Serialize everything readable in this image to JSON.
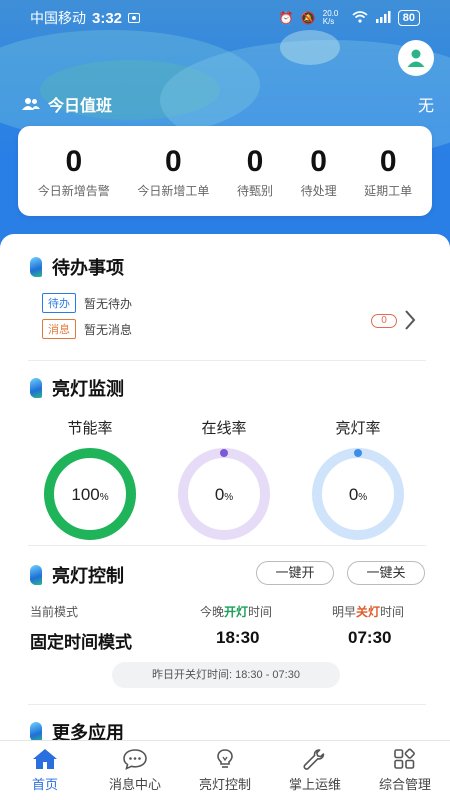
{
  "status_bar": {
    "carrier": "中国移动",
    "time": "3:32",
    "speed": "20.0 K/s",
    "battery": "80"
  },
  "duty": {
    "title": "今日值班",
    "value": "无"
  },
  "stats": [
    {
      "value": "0",
      "label": "今日新增告警"
    },
    {
      "value": "0",
      "label": "今日新增工单"
    },
    {
      "value": "0",
      "label": "待甄别"
    },
    {
      "value": "0",
      "label": "待处理"
    },
    {
      "value": "0",
      "label": "延期工单"
    }
  ],
  "todo": {
    "title": "待办事项",
    "items": [
      {
        "tag": "待办",
        "text": "暂无待办"
      },
      {
        "tag": "消息",
        "text": "暂无消息"
      }
    ],
    "count": "0"
  },
  "monitor": {
    "title": "亮灯监测",
    "gauges": [
      {
        "label": "节能率",
        "value": "100",
        "unit": "%",
        "fraction": 1.0,
        "color": "#1fb35a",
        "track": "#e3f5ea"
      },
      {
        "label": "在线率",
        "value": "0",
        "unit": "%",
        "fraction": 0.0,
        "color": "#7a5ad6",
        "track": "#e6dcf8"
      },
      {
        "label": "亮灯率",
        "value": "0",
        "unit": "%",
        "fraction": 0.0,
        "color": "#3d8ee8",
        "track": "#cfe4fb"
      }
    ]
  },
  "control": {
    "title": "亮灯控制",
    "btn_on": "一键开",
    "btn_off": "一键关",
    "mode_label": "当前模式",
    "mode_value": "固定时间模式",
    "tonight_pre": "今晚",
    "tonight_hl": "开灯",
    "tonight_post": "时间",
    "tonight_value": "18:30",
    "morning_pre": "明早",
    "morning_hl": "关灯",
    "morning_post": "时间",
    "morning_value": "07:30",
    "yesterday": "昨日开关灯时间:  18:30 - 07:30"
  },
  "more": {
    "title": "更多应用"
  },
  "tabs": [
    {
      "label": "首页",
      "icon": "home-icon",
      "active": true
    },
    {
      "label": "消息中心",
      "icon": "chat-icon",
      "active": false
    },
    {
      "label": "亮灯控制",
      "icon": "bulb-icon",
      "active": false
    },
    {
      "label": "掌上运维",
      "icon": "wrench-icon",
      "active": false
    },
    {
      "label": "综合管理",
      "icon": "grid-icon",
      "active": false
    }
  ],
  "colors": {
    "primary": "#2a7fe6",
    "tab_active": "#2a6fe0"
  }
}
